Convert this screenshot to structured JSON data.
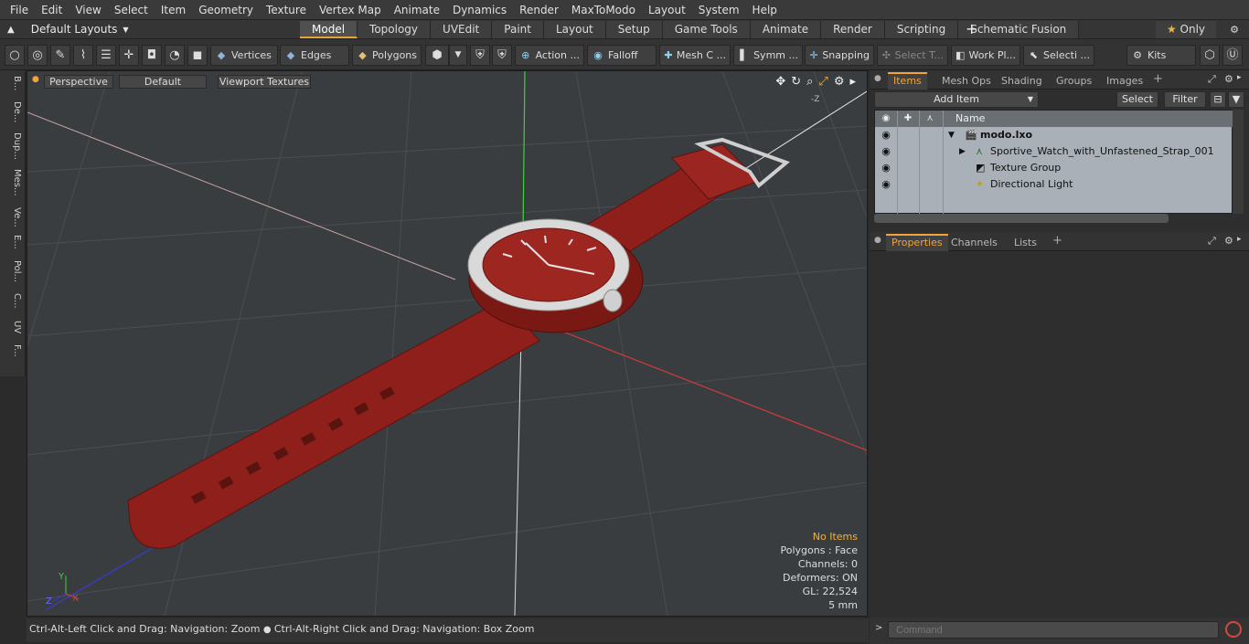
{
  "menu": [
    "File",
    "Edit",
    "View",
    "Select",
    "Item",
    "Geometry",
    "Texture",
    "Vertex Map",
    "Animate",
    "Dynamics",
    "Render",
    "MaxToModo",
    "Layout",
    "System",
    "Help"
  ],
  "layout_select": "Default Layouts",
  "tabs": [
    "Model",
    "Topology",
    "UVEdit",
    "Paint",
    "Layout",
    "Setup",
    "Game Tools",
    "Animate",
    "Render",
    "Scripting",
    "Schematic Fusion"
  ],
  "only_label": "Only",
  "toolbar": {
    "vertices": "Vertices",
    "edges": "Edges",
    "polygons": "Polygons",
    "action": "Action ...",
    "falloff": "Falloff",
    "mesh": "Mesh C ...",
    "symm": "Symm ...",
    "snapping": "Snapping",
    "select_t": "Select T...",
    "work_pl": "Work Pl...",
    "selecti": "Selecti ...",
    "kits": "Kits"
  },
  "left_tabs": [
    "B...",
    "De...",
    "Dup...",
    "Mes...",
    "Ve...",
    "E...",
    "Pol...",
    "C...",
    "UV",
    "F..."
  ],
  "viewport": {
    "view_mode": "Perspective",
    "shading": "Default",
    "textures": "Viewport Textures",
    "info": {
      "selection": "No Items",
      "polygons": "Polygons : Face",
      "channels": "Channels: 0",
      "deformers": "Deformers: ON",
      "gl": "GL: 22,524",
      "unit": "5 mm"
    },
    "axis_labels": {
      "y": "Y",
      "x": "X",
      "z": "Z",
      "neg_z": "-Z"
    }
  },
  "status_bar": {
    "part1": "Ctrl-Alt-Left Click and Drag: Navigation: Zoom",
    "part2": "Ctrl-Alt-Right Click and Drag: Navigation: Box Zoom"
  },
  "items_panel": {
    "tabs": [
      "Items",
      "Mesh Ops",
      "Shading",
      "Groups",
      "Images"
    ],
    "add_item": "Add Item",
    "select": "Select",
    "filter": "Filter",
    "name_header": "Name",
    "rows": [
      "modo.lxo",
      "Sportive_Watch_with_Unfastened_Strap_001",
      "Texture Group",
      "Directional Light"
    ]
  },
  "properties_panel": {
    "tabs": [
      "Properties",
      "Channels",
      "Lists"
    ]
  },
  "command": {
    "placeholder": "Command"
  },
  "colors": {
    "accent": "#f2a33a",
    "strap": "#8f1f1a",
    "viewport_bg": "#3a3d40",
    "table_bg": "#a9b0b7"
  }
}
